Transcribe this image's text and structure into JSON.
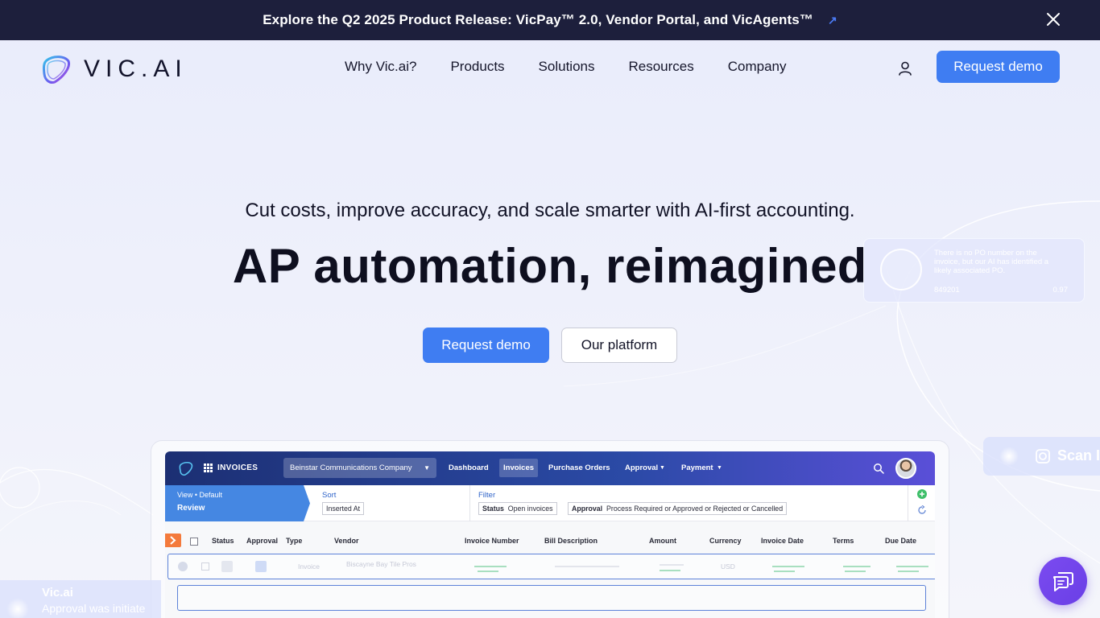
{
  "announcement": {
    "text": "Explore the Q2 2025 Product Release: VicPay™ 2.0, Vendor Portal, and VicAgents™",
    "arrow": "↗",
    "icons": [
      "arrow-up-right-icon",
      "close-icon"
    ]
  },
  "header": {
    "logo_text": "VIC.AI",
    "nav": [
      "Why Vic.ai?",
      "Products",
      "Solutions",
      "Resources",
      "Company"
    ],
    "cta": "Request demo",
    "icons": [
      "user-icon"
    ]
  },
  "hero": {
    "subtitle": "Cut costs, improve accuracy, and scale smarter with AI-first accounting.",
    "title": "AP automation, reimagined",
    "primary_cta": "Request demo",
    "secondary_cta": "Our platform"
  },
  "ai_card": {
    "message": "There is no PO number on the invoice, but our AI has identified a likely associated PO.",
    "code": "849201",
    "score": "0.97"
  },
  "scan_card": {
    "label": "Scan I"
  },
  "mockup": {
    "section": "INVOICES",
    "company": "Beinstar Communications Company",
    "nav": [
      "Dashboard",
      "Invoices",
      "Purchase Orders",
      "Approval",
      "Payment"
    ],
    "view_label": "View • Default",
    "view_name": "Review",
    "sort_label": "Sort",
    "sort_value": "Inserted At",
    "filter_label": "Filter",
    "status_key": "Status",
    "status_value": "Open invoices",
    "approval_key": "Approval",
    "approval_value": "Process Required or Approved or Rejected or Cancelled",
    "columns": [
      "Status",
      "Approval",
      "Type",
      "Vendor",
      "Invoice Number",
      "Bill Description",
      "Amount",
      "Currency",
      "Invoice Date",
      "Terms",
      "Due Date"
    ],
    "row": {
      "type": "Invoice",
      "vendor": "Biscayne Bay Tile Pros",
      "currency": "USD"
    }
  },
  "toast": {
    "title": "Vic.ai",
    "text": "Approval was initiate"
  },
  "colors": {
    "accent": "#3f7df2",
    "announcement_bg": "#1d1f3c",
    "chat": "#7b4bf0",
    "sort_tag": "#f47a3c"
  }
}
